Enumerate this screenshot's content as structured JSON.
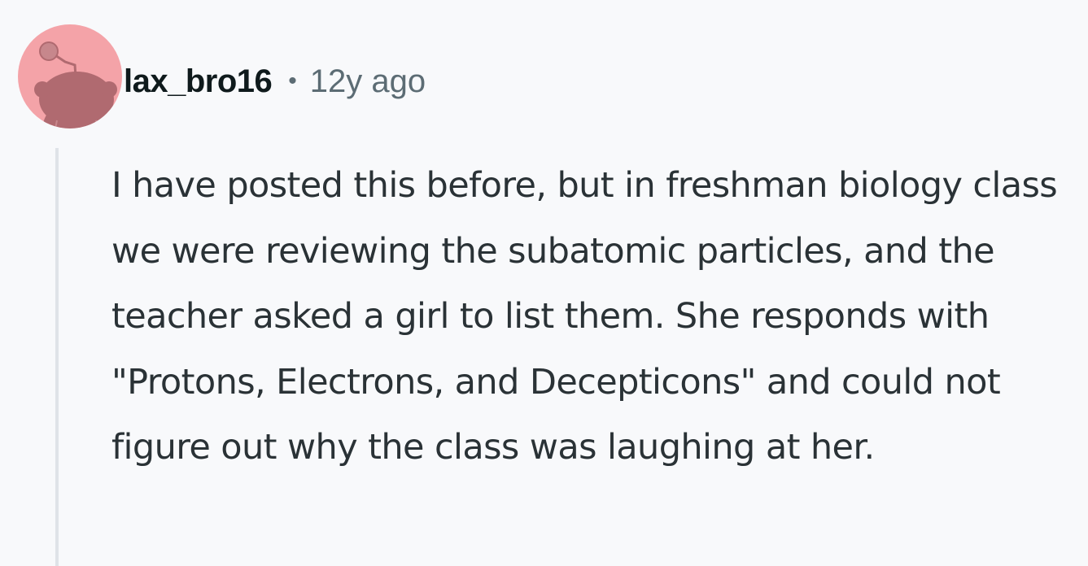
{
  "comment": {
    "author": "lax_bro16",
    "separator": "•",
    "age": "12y ago",
    "body": "I have posted this before, but in freshman biology class we were reviewing the subatomic particles, and the teacher asked a girl to list them. She responds with \"Protons, Electrons, and Decepticons\" and could not figure out why the class was laughing at her."
  },
  "icons": {
    "avatar": "reddit-snoo-avatar-icon"
  },
  "colors": {
    "avatar_bg": "#f4a3a8",
    "avatar_figure": "#b06a70",
    "username": "#0f1a1c",
    "meta_gray": "#5c6c74",
    "body_text": "#2a3236",
    "thread_line": "#dfe3e8",
    "page_bg": "#f8f9fb"
  }
}
